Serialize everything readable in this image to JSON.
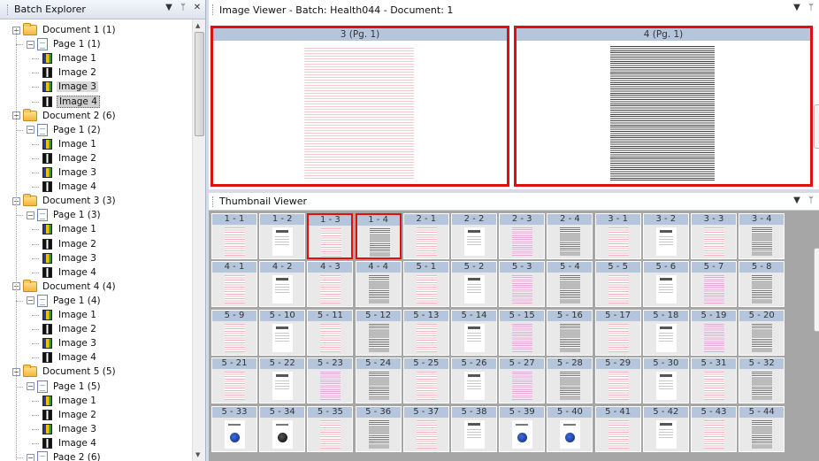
{
  "explorer": {
    "title": "Batch Explorer",
    "tree": [
      {
        "label": "Document 1 (1)",
        "kind": "doc"
      },
      {
        "label": "Page 1 (1)",
        "kind": "page"
      },
      {
        "label": "Image 1",
        "kind": "img",
        "icon": "color"
      },
      {
        "label": "Image 2",
        "kind": "img",
        "icon": "bw"
      },
      {
        "label": "Image 3",
        "kind": "img",
        "icon": "color",
        "state": "hl"
      },
      {
        "label": "Image 4",
        "kind": "img",
        "icon": "bw",
        "state": "sel"
      },
      {
        "label": "Document 2 (6)",
        "kind": "doc"
      },
      {
        "label": "Page 1 (2)",
        "kind": "page"
      },
      {
        "label": "Image 1",
        "kind": "img",
        "icon": "color"
      },
      {
        "label": "Image 2",
        "kind": "img",
        "icon": "bw"
      },
      {
        "label": "Image 3",
        "kind": "img",
        "icon": "color"
      },
      {
        "label": "Image 4",
        "kind": "img",
        "icon": "bw"
      },
      {
        "label": "Document 3 (3)",
        "kind": "doc"
      },
      {
        "label": "Page 1 (3)",
        "kind": "page"
      },
      {
        "label": "Image 1",
        "kind": "img",
        "icon": "color"
      },
      {
        "label": "Image 2",
        "kind": "img",
        "icon": "bw"
      },
      {
        "label": "Image 3",
        "kind": "img",
        "icon": "color"
      },
      {
        "label": "Image 4",
        "kind": "img",
        "icon": "bw"
      },
      {
        "label": "Document 4 (4)",
        "kind": "doc"
      },
      {
        "label": "Page 1 (4)",
        "kind": "page"
      },
      {
        "label": "Image 1",
        "kind": "img",
        "icon": "color"
      },
      {
        "label": "Image 2",
        "kind": "img",
        "icon": "bw"
      },
      {
        "label": "Image 3",
        "kind": "img",
        "icon": "color"
      },
      {
        "label": "Image 4",
        "kind": "img",
        "icon": "bw"
      },
      {
        "label": "Document 5 (5)",
        "kind": "doc"
      },
      {
        "label": "Page 1 (5)",
        "kind": "page"
      },
      {
        "label": "Image 1",
        "kind": "img",
        "icon": "color"
      },
      {
        "label": "Image 2",
        "kind": "img",
        "icon": "bw"
      },
      {
        "label": "Image 3",
        "kind": "img",
        "icon": "color"
      },
      {
        "label": "Image 4",
        "kind": "img",
        "icon": "bw"
      },
      {
        "label": "Page 2 (6)",
        "kind": "page"
      }
    ]
  },
  "viewer": {
    "title": "Image Viewer - Batch: Health044 - Document: 1",
    "pages": [
      {
        "caption": "3 (Pg. 1)",
        "style": "red"
      },
      {
        "caption": "4 (Pg. 1)",
        "style": "text"
      }
    ]
  },
  "thumbnails": {
    "title": "Thumbnail Viewer",
    "items": [
      {
        "label": "1 - 1",
        "style": "r"
      },
      {
        "label": "1 - 2",
        "style": "f"
      },
      {
        "label": "1 - 3",
        "style": "r",
        "selected": true
      },
      {
        "label": "1 - 4",
        "style": "t",
        "selected": true
      },
      {
        "label": "2 - 1",
        "style": "r"
      },
      {
        "label": "2 - 2",
        "style": "f"
      },
      {
        "label": "2 - 3",
        "style": "p"
      },
      {
        "label": "2 - 4",
        "style": "t"
      },
      {
        "label": "3 - 1",
        "style": "r"
      },
      {
        "label": "3 - 2",
        "style": "f"
      },
      {
        "label": "3 - 3",
        "style": "r"
      },
      {
        "label": "3 - 4",
        "style": "t"
      },
      {
        "label": "4 - 1",
        "style": "r"
      },
      {
        "label": "4 - 2",
        "style": "f"
      },
      {
        "label": "4 - 3",
        "style": "r"
      },
      {
        "label": "4 - 4",
        "style": "t"
      },
      {
        "label": "5 - 1",
        "style": "r"
      },
      {
        "label": "5 - 2",
        "style": "f"
      },
      {
        "label": "5 - 3",
        "style": "p"
      },
      {
        "label": "5 - 4",
        "style": "t"
      },
      {
        "label": "5 - 5",
        "style": "r"
      },
      {
        "label": "5 - 6",
        "style": "f"
      },
      {
        "label": "5 - 7",
        "style": "p"
      },
      {
        "label": "5 - 8",
        "style": "t"
      },
      {
        "label": "5 - 9",
        "style": "r"
      },
      {
        "label": "5 - 10",
        "style": "f"
      },
      {
        "label": "5 - 11",
        "style": "r"
      },
      {
        "label": "5 - 12",
        "style": "t"
      },
      {
        "label": "5 - 13",
        "style": "r"
      },
      {
        "label": "5 - 14",
        "style": "f"
      },
      {
        "label": "5 - 15",
        "style": "p"
      },
      {
        "label": "5 - 16",
        "style": "t"
      },
      {
        "label": "5 - 17",
        "style": "r"
      },
      {
        "label": "5 - 18",
        "style": "f"
      },
      {
        "label": "5 - 19",
        "style": "p"
      },
      {
        "label": "5 - 20",
        "style": "t"
      },
      {
        "label": "5 - 21",
        "style": "r"
      },
      {
        "label": "5 - 22",
        "style": "f"
      },
      {
        "label": "5 - 23",
        "style": "p"
      },
      {
        "label": "5 - 24",
        "style": "t"
      },
      {
        "label": "5 - 25",
        "style": "r"
      },
      {
        "label": "5 - 26",
        "style": "f"
      },
      {
        "label": "5 - 27",
        "style": "p"
      },
      {
        "label": "5 - 28",
        "style": "t"
      },
      {
        "label": "5 - 29",
        "style": "r"
      },
      {
        "label": "5 - 30",
        "style": "f"
      },
      {
        "label": "5 - 31",
        "style": "r"
      },
      {
        "label": "5 - 32",
        "style": "t"
      },
      {
        "label": "5 - 33",
        "style": "g"
      },
      {
        "label": "5 - 34",
        "style": "gk"
      },
      {
        "label": "5 - 35",
        "style": "r"
      },
      {
        "label": "5 - 36",
        "style": "t"
      },
      {
        "label": "5 - 37",
        "style": "r"
      },
      {
        "label": "5 - 38",
        "style": "f"
      },
      {
        "label": "5 - 39",
        "style": "g"
      },
      {
        "label": "5 - 40",
        "style": "g"
      },
      {
        "label": "5 - 41",
        "style": "r"
      },
      {
        "label": "5 - 42",
        "style": "f"
      },
      {
        "label": "5 - 43",
        "style": "r"
      },
      {
        "label": "5 - 44",
        "style": "t"
      }
    ]
  },
  "colors": {
    "selection_border": "#e01010",
    "caption_bar": "#b5c6dc"
  }
}
